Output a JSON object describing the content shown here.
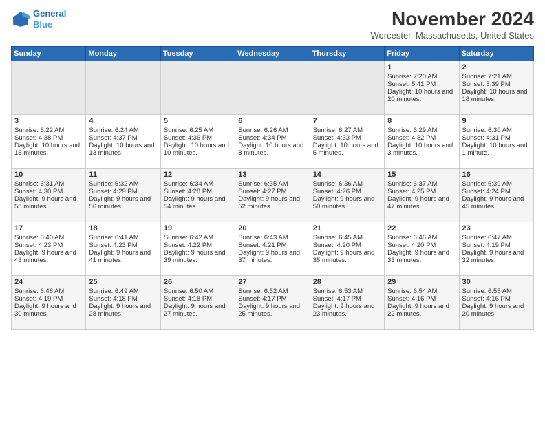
{
  "header": {
    "logo_line1": "General",
    "logo_line2": "Blue",
    "month": "November 2024",
    "location": "Worcester, Massachusetts, United States"
  },
  "weekdays": [
    "Sunday",
    "Monday",
    "Tuesday",
    "Wednesday",
    "Thursday",
    "Friday",
    "Saturday"
  ],
  "rows": [
    [
      {
        "day": "",
        "empty": true
      },
      {
        "day": "",
        "empty": true
      },
      {
        "day": "",
        "empty": true
      },
      {
        "day": "",
        "empty": true
      },
      {
        "day": "",
        "empty": true
      },
      {
        "day": "1",
        "sunrise": "Sunrise: 7:20 AM",
        "sunset": "Sunset: 5:41 PM",
        "daylight": "Daylight: 10 hours and 20 minutes."
      },
      {
        "day": "2",
        "sunrise": "Sunrise: 7:21 AM",
        "sunset": "Sunset: 5:39 PM",
        "daylight": "Daylight: 10 hours and 18 minutes."
      }
    ],
    [
      {
        "day": "3",
        "sunrise": "Sunrise: 6:22 AM",
        "sunset": "Sunset: 4:38 PM",
        "daylight": "Daylight: 10 hours and 15 minutes."
      },
      {
        "day": "4",
        "sunrise": "Sunrise: 6:24 AM",
        "sunset": "Sunset: 4:37 PM",
        "daylight": "Daylight: 10 hours and 13 minutes."
      },
      {
        "day": "5",
        "sunrise": "Sunrise: 6:25 AM",
        "sunset": "Sunset: 4:36 PM",
        "daylight": "Daylight: 10 hours and 10 minutes."
      },
      {
        "day": "6",
        "sunrise": "Sunrise: 6:26 AM",
        "sunset": "Sunset: 4:34 PM",
        "daylight": "Daylight: 10 hours and 8 minutes."
      },
      {
        "day": "7",
        "sunrise": "Sunrise: 6:27 AM",
        "sunset": "Sunset: 4:33 PM",
        "daylight": "Daylight: 10 hours and 5 minutes."
      },
      {
        "day": "8",
        "sunrise": "Sunrise: 6:29 AM",
        "sunset": "Sunset: 4:32 PM",
        "daylight": "Daylight: 10 hours and 3 minutes."
      },
      {
        "day": "9",
        "sunrise": "Sunrise: 6:30 AM",
        "sunset": "Sunset: 4:31 PM",
        "daylight": "Daylight: 10 hours and 1 minute."
      }
    ],
    [
      {
        "day": "10",
        "sunrise": "Sunrise: 6:31 AM",
        "sunset": "Sunset: 4:30 PM",
        "daylight": "Daylight: 9 hours and 58 minutes."
      },
      {
        "day": "11",
        "sunrise": "Sunrise: 6:32 AM",
        "sunset": "Sunset: 4:29 PM",
        "daylight": "Daylight: 9 hours and 56 minutes."
      },
      {
        "day": "12",
        "sunrise": "Sunrise: 6:34 AM",
        "sunset": "Sunset: 4:28 PM",
        "daylight": "Daylight: 9 hours and 54 minutes."
      },
      {
        "day": "13",
        "sunrise": "Sunrise: 6:35 AM",
        "sunset": "Sunset: 4:27 PM",
        "daylight": "Daylight: 9 hours and 52 minutes."
      },
      {
        "day": "14",
        "sunrise": "Sunrise: 6:36 AM",
        "sunset": "Sunset: 4:26 PM",
        "daylight": "Daylight: 9 hours and 50 minutes."
      },
      {
        "day": "15",
        "sunrise": "Sunrise: 6:37 AM",
        "sunset": "Sunset: 4:25 PM",
        "daylight": "Daylight: 9 hours and 47 minutes."
      },
      {
        "day": "16",
        "sunrise": "Sunrise: 6:39 AM",
        "sunset": "Sunset: 4:24 PM",
        "daylight": "Daylight: 9 hours and 45 minutes."
      }
    ],
    [
      {
        "day": "17",
        "sunrise": "Sunrise: 6:40 AM",
        "sunset": "Sunset: 4:23 PM",
        "daylight": "Daylight: 9 hours and 43 minutes."
      },
      {
        "day": "18",
        "sunrise": "Sunrise: 6:41 AM",
        "sunset": "Sunset: 4:23 PM",
        "daylight": "Daylight: 9 hours and 41 minutes."
      },
      {
        "day": "19",
        "sunrise": "Sunrise: 6:42 AM",
        "sunset": "Sunset: 4:22 PM",
        "daylight": "Daylight: 9 hours and 39 minutes."
      },
      {
        "day": "20",
        "sunrise": "Sunrise: 6:43 AM",
        "sunset": "Sunset: 4:21 PM",
        "daylight": "Daylight: 9 hours and 37 minutes."
      },
      {
        "day": "21",
        "sunrise": "Sunrise: 6:45 AM",
        "sunset": "Sunset: 4:20 PM",
        "daylight": "Daylight: 9 hours and 35 minutes."
      },
      {
        "day": "22",
        "sunrise": "Sunrise: 6:46 AM",
        "sunset": "Sunset: 4:20 PM",
        "daylight": "Daylight: 9 hours and 33 minutes."
      },
      {
        "day": "23",
        "sunrise": "Sunrise: 6:47 AM",
        "sunset": "Sunset: 4:19 PM",
        "daylight": "Daylight: 9 hours and 32 minutes."
      }
    ],
    [
      {
        "day": "24",
        "sunrise": "Sunrise: 6:48 AM",
        "sunset": "Sunset: 4:19 PM",
        "daylight": "Daylight: 9 hours and 30 minutes."
      },
      {
        "day": "25",
        "sunrise": "Sunrise: 6:49 AM",
        "sunset": "Sunset: 4:18 PM",
        "daylight": "Daylight: 9 hours and 28 minutes."
      },
      {
        "day": "26",
        "sunrise": "Sunrise: 6:50 AM",
        "sunset": "Sunset: 4:18 PM",
        "daylight": "Daylight: 9 hours and 27 minutes."
      },
      {
        "day": "27",
        "sunrise": "Sunrise: 6:52 AM",
        "sunset": "Sunset: 4:17 PM",
        "daylight": "Daylight: 9 hours and 25 minutes."
      },
      {
        "day": "28",
        "sunrise": "Sunrise: 6:53 AM",
        "sunset": "Sunset: 4:17 PM",
        "daylight": "Daylight: 9 hours and 23 minutes."
      },
      {
        "day": "29",
        "sunrise": "Sunrise: 6:54 AM",
        "sunset": "Sunset: 4:16 PM",
        "daylight": "Daylight: 9 hours and 22 minutes."
      },
      {
        "day": "30",
        "sunrise": "Sunrise: 6:55 AM",
        "sunset": "Sunset: 4:16 PM",
        "daylight": "Daylight: 9 hours and 20 minutes."
      }
    ]
  ]
}
